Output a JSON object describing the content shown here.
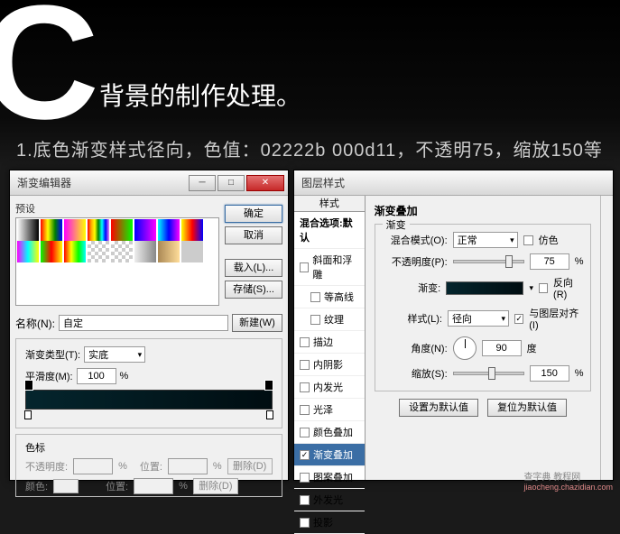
{
  "header": {
    "big_letter": "C",
    "title": "背景的制作处理。",
    "desc": "1.底色渐变样式径向，色值：02222b 000d11，不透明75，缩放150等"
  },
  "gradient_editor": {
    "window_title": "渐变编辑器",
    "presets_label": "预设",
    "buttons": {
      "ok": "确定",
      "cancel": "取消",
      "load": "载入(L)...",
      "save": "存储(S)..."
    },
    "name_label": "名称(N):",
    "name_value": "自定",
    "new_btn": "新建(W)",
    "type_label": "渐变类型(T):",
    "type_value": "实底",
    "smooth_label": "平滑度(M):",
    "smooth_value": "100",
    "smooth_unit": "%",
    "color_stops_label": "色标",
    "opacity_label": "不透明度:",
    "position_label": "位置:",
    "color_label": "颜色:",
    "percent": "%",
    "delete_btn": "删除(D)"
  },
  "layer_style": {
    "window_title": "图层样式",
    "styles_header": "样式",
    "blend_options": "混合选项:默认",
    "effects": [
      {
        "label": "斜面和浮雕",
        "checked": false
      },
      {
        "label": "等高线",
        "checked": false,
        "indent": true
      },
      {
        "label": "纹理",
        "checked": false,
        "indent": true
      },
      {
        "label": "描边",
        "checked": false
      },
      {
        "label": "内阴影",
        "checked": false
      },
      {
        "label": "内发光",
        "checked": false
      },
      {
        "label": "光泽",
        "checked": false
      },
      {
        "label": "颜色叠加",
        "checked": false
      },
      {
        "label": "渐变叠加",
        "checked": true,
        "selected": true
      },
      {
        "label": "图案叠加",
        "checked": false
      },
      {
        "label": "外发光",
        "checked": false
      },
      {
        "label": "投影",
        "checked": false
      }
    ],
    "panel_title": "渐变叠加",
    "gradient_group": "渐变",
    "blend_mode_label": "混合模式(O):",
    "blend_mode_value": "正常",
    "dither_label": "仿色",
    "opacity_label": "不透明度(P):",
    "opacity_value": "75",
    "gradient_label": "渐变:",
    "reverse_label": "反向(R)",
    "style_label": "样式(L):",
    "style_value": "径向",
    "align_label": "与图层对齐(I)",
    "angle_label": "角度(N):",
    "angle_value": "90",
    "angle_unit": "度",
    "scale_label": "缩放(S):",
    "scale_value": "150",
    "percent": "%",
    "set_default": "设置为默认值",
    "reset_default": "复位为默认值"
  },
  "watermark": {
    "main": "查字典 教程网",
    "sub": "jiaocheng.chazidian.com"
  }
}
